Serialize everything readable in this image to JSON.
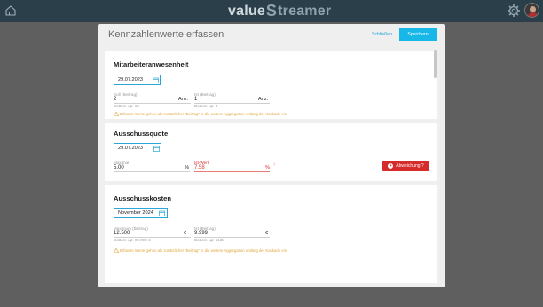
{
  "app": {
    "logo_value": "value",
    "logo_streamer": "treamer",
    "logo_s": "S"
  },
  "modal": {
    "title": "Kennzahlenwerte erfassen",
    "close_label": "Schließen",
    "save_label": "Speichern"
  },
  "cards": [
    {
      "title": "Mitarbeiteranwesenheit",
      "date": "29.07.2023",
      "soll_label": "Soll (Beitrag)",
      "soll_value": "2",
      "soll_unit": "Anz.",
      "soll_bottom": "Bottom-up: 10",
      "ist_label": "Ist (Beitrag)",
      "ist_value": "1",
      "ist_unit": "Anz.",
      "ist_bottom": "Bottom-up: 8",
      "note": "Erfasste Werte gehen als zusätzlicher \"Beitrag\" in die weitere Aggregation entlang der Kaskade ein"
    },
    {
      "title": "Ausschussquote",
      "date": "29.07.2023",
      "max_label": "Maximal",
      "max_value": "5,00",
      "max_unit": "%",
      "ist_label": "Ist-Wert",
      "ist_value": "7,58",
      "ist_unit": "%",
      "deviation_label": "Abweichung ?"
    },
    {
      "title": "Ausschusskosten",
      "date": "November 2024",
      "max_label": "Maximum (Beitrag)",
      "max_value": "12.500",
      "max_unit": "€",
      "max_bottom": "Bottom-up: 99.999 €",
      "ist_label": "Ist (Beitrag)",
      "ist_value": "9.999",
      "ist_unit": "€",
      "ist_bottom": "Bottom-up: 513k",
      "note": "Erfasste Werte gehen als zusätzlicher \"Beitrag\" in die weitere Aggregation entlang der Kaskade ein"
    }
  ],
  "colors": {
    "topbar": "#2b3f4a",
    "accent": "#17b8e8",
    "warning": "#e0a53a",
    "error": "#d62b2b"
  },
  "icons": [
    "home-icon",
    "gear-icon",
    "avatar",
    "calendar-icon",
    "warning-icon",
    "chevron-right-icon",
    "plus-circle-icon"
  ]
}
